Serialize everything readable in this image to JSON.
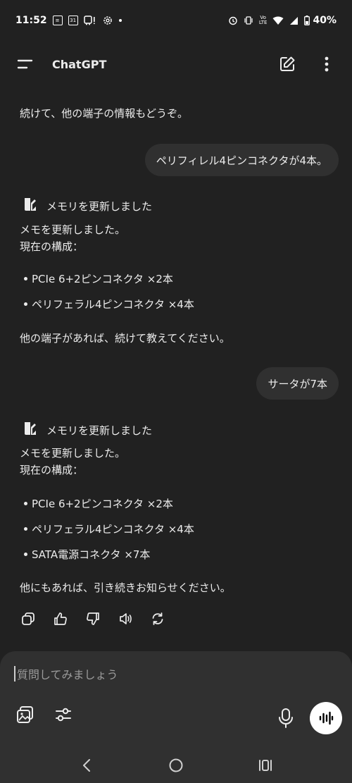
{
  "status": {
    "time": "11:52",
    "battery": "40%"
  },
  "app_bar": {
    "title": "ChatGPT"
  },
  "conversation": {
    "assistant_1": "続けて、他の端子の情報もどうぞ。",
    "user_1": "ペリフィレル4ピンコネクタが4本。",
    "memory_label_1": "メモリを更新しました",
    "assistant_2_line1": "メモを更新しました。",
    "assistant_2_line2": "現在の構成：",
    "assistant_2_items": [
      "PCIe 6+2ピンコネクタ ×2本",
      "ペリフェラル4ピンコネクタ ×4本"
    ],
    "assistant_2_outro": "他の端子があれば、続けて教えてください。",
    "user_2": "サータが7本",
    "memory_label_2": "メモリを更新しました",
    "assistant_3_line1": "メモを更新しました。",
    "assistant_3_line2": "現在の構成：",
    "assistant_3_items": [
      "PCIe 6+2ピンコネクタ ×2本",
      "ペリフェラル4ピンコネクタ ×4本",
      "SATA電源コネクタ ×7本"
    ],
    "assistant_3_outro": "他にもあれば、引き続きお知らせください。"
  },
  "composer": {
    "placeholder": "質問してみましょう"
  },
  "icons": {
    "menu": "menu-icon",
    "new_chat": "edit-icon",
    "more": "more-vertical-icon",
    "memory": "memory-icon",
    "copy": "copy-icon",
    "thumbs_up": "thumbs-up-icon",
    "thumbs_down": "thumbs-down-icon",
    "read_aloud": "speaker-icon",
    "regenerate": "refresh-icon",
    "attach_image": "image-icon",
    "tools": "sliders-icon",
    "mic": "mic-icon",
    "voice_mode": "waveform-icon"
  },
  "colors": {
    "background": "#212121",
    "bubble": "#303030",
    "text": "#ececec"
  }
}
